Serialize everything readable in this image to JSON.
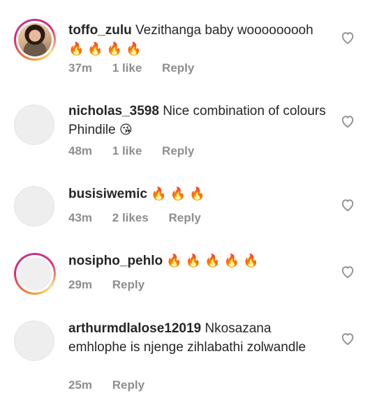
{
  "comments": [
    {
      "username": "toffo_zulu",
      "text": "Vezithanga baby wooooooooh",
      "emoji": "🔥 🔥 🔥 🔥",
      "time": "37m",
      "likes": "1 like",
      "reply": "Reply"
    },
    {
      "username": "nicholas_3598",
      "text": "Nice combination of colours Phindile",
      "emoji": "😘",
      "time": "48m",
      "likes": "1 like",
      "reply": "Reply"
    },
    {
      "username": "busisiwemic",
      "text": "",
      "emoji": "🔥 🔥 🔥",
      "time": "43m",
      "likes": "2 likes",
      "reply": "Reply"
    },
    {
      "username": "nosipho_pehlo",
      "text": "",
      "emoji": "🔥 🔥 🔥 🔥 🔥",
      "time": "29m",
      "likes": "",
      "reply": "Reply"
    },
    {
      "username": "arthurmdlalose12019",
      "text": "Nkosazana emhlophe is njenge zihlabathi zolwandle",
      "emoji": "",
      "time": "25m",
      "likes": "",
      "reply": "Reply"
    }
  ],
  "icons": {
    "heart": "heart-outline-icon"
  },
  "colors": {
    "text": "#262626",
    "meta": "#8e8e8e",
    "story_ring_start": "#f58529",
    "story_ring_end": "#dd2a7b"
  }
}
